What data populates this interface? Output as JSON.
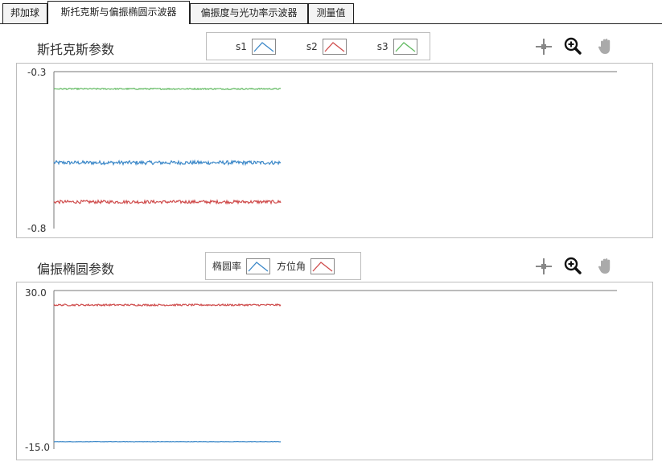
{
  "tabs": [
    {
      "label": "邦加球",
      "active": false
    },
    {
      "label": "斯托克斯与偏振椭圆示波器",
      "active": true
    },
    {
      "label": "偏振度与光功率示波器",
      "active": false
    },
    {
      "label": "测量值",
      "active": false
    }
  ],
  "colors": {
    "s1": "#3a87c8",
    "s2": "#cf4b4b",
    "s3": "#5fb95f",
    "axis": "#777777"
  },
  "toolbar_icons": [
    "crosshair-icon",
    "zoom-in-icon",
    "pan-hand-icon"
  ],
  "stokes": {
    "title": "斯托克斯参数",
    "legend": [
      "s1",
      "s2",
      "s3"
    ],
    "y_max_label": "-0.3",
    "y_min_label": "-0.8"
  },
  "ellipse": {
    "title": "偏振椭圆参数",
    "legend": [
      "椭圆率",
      "方位角"
    ],
    "y_max_label": "30.0",
    "y_min_label": "-15.0"
  },
  "chart_data": [
    {
      "type": "line",
      "title": "斯托克斯参数",
      "ylim": [
        -0.8,
        -0.3
      ],
      "series": [
        {
          "name": "s1",
          "color": "#3a87c8",
          "mean": -0.59,
          "noise": 0.006
        },
        {
          "name": "s2",
          "color": "#cf4b4b",
          "mean": -0.715,
          "noise": 0.005
        },
        {
          "name": "s3",
          "color": "#5fb95f",
          "mean": -0.355,
          "noise": 0.002
        }
      ]
    },
    {
      "type": "line",
      "title": "偏振椭圆参数",
      "ylim": [
        -15.0,
        30.0
      ],
      "series": [
        {
          "name": "椭圆率",
          "color": "#3a87c8",
          "mean": -12.9,
          "noise": 0.05
        },
        {
          "name": "方位角",
          "color": "#cf4b4b",
          "mean": 25.9,
          "noise": 0.25
        }
      ]
    }
  ]
}
